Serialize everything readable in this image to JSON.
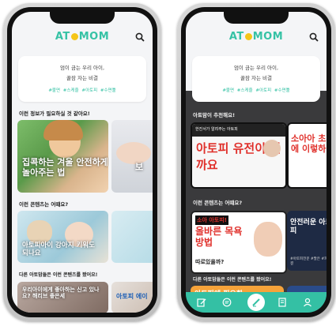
{
  "left_phone": {
    "brand": {
      "pre": "AT",
      "post": "MOM"
    },
    "banner": {
      "line1": "엄이 금는 우리 아이,",
      "line2": "꿀잠 자는 비결",
      "tags": "#불면 #스케줄 #아토피 #수면툴"
    },
    "section1": "이런 정보가 필요하실 것 같아요!",
    "card1_caption": "집콕하는 겨울 안전하게 놀아주는 법",
    "card2_caption": "보",
    "section2": "이런 콘텐츠는 어떄요?",
    "card3_caption": "아토피아이 강아지 키워도 되나요",
    "section3": "다른 아토맘들은 이런 콘텐츠를 봤어요!",
    "card4_caption": "우리아이에게 좋아하는 신고 있나요? 해리브 좋은세",
    "card5_caption": "아토피 에이"
  },
  "right_phone": {
    "brand": {
      "pre": "AT",
      "post": "MOM"
    },
    "banner": {
      "line1": "엄이 금는 우리 아이,",
      "line2": "꿀잠 자는 비결",
      "tags": "#불면 #스케줄 #아토피 #수면툴"
    },
    "section1": "아토맘이 추천해요!",
    "card1_top": "아토피 유전이 될까요",
    "card1_small": "한진서가 알려주는 아토피",
    "card2_top": "소아아 초기에 이렇하",
    "section2": "이런 콘텐츠는 어떄요?",
    "card3_top": "소아 아토피!",
    "card3_main": "올바른 목욕방법",
    "card3_sub": "따로있을까?",
    "card4_top": "안전러운 아토피",
    "card4_tag": "#아토피전문 #팔은 #피부결",
    "section3": "다른 아토맘들은 이런 콘텐츠를 봤어요!",
    "card5_top": "아토피에 필요한",
    "tabs": [
      "edit-icon",
      "message-icon",
      "pen-icon",
      "book-icon",
      "person-icon"
    ]
  }
}
